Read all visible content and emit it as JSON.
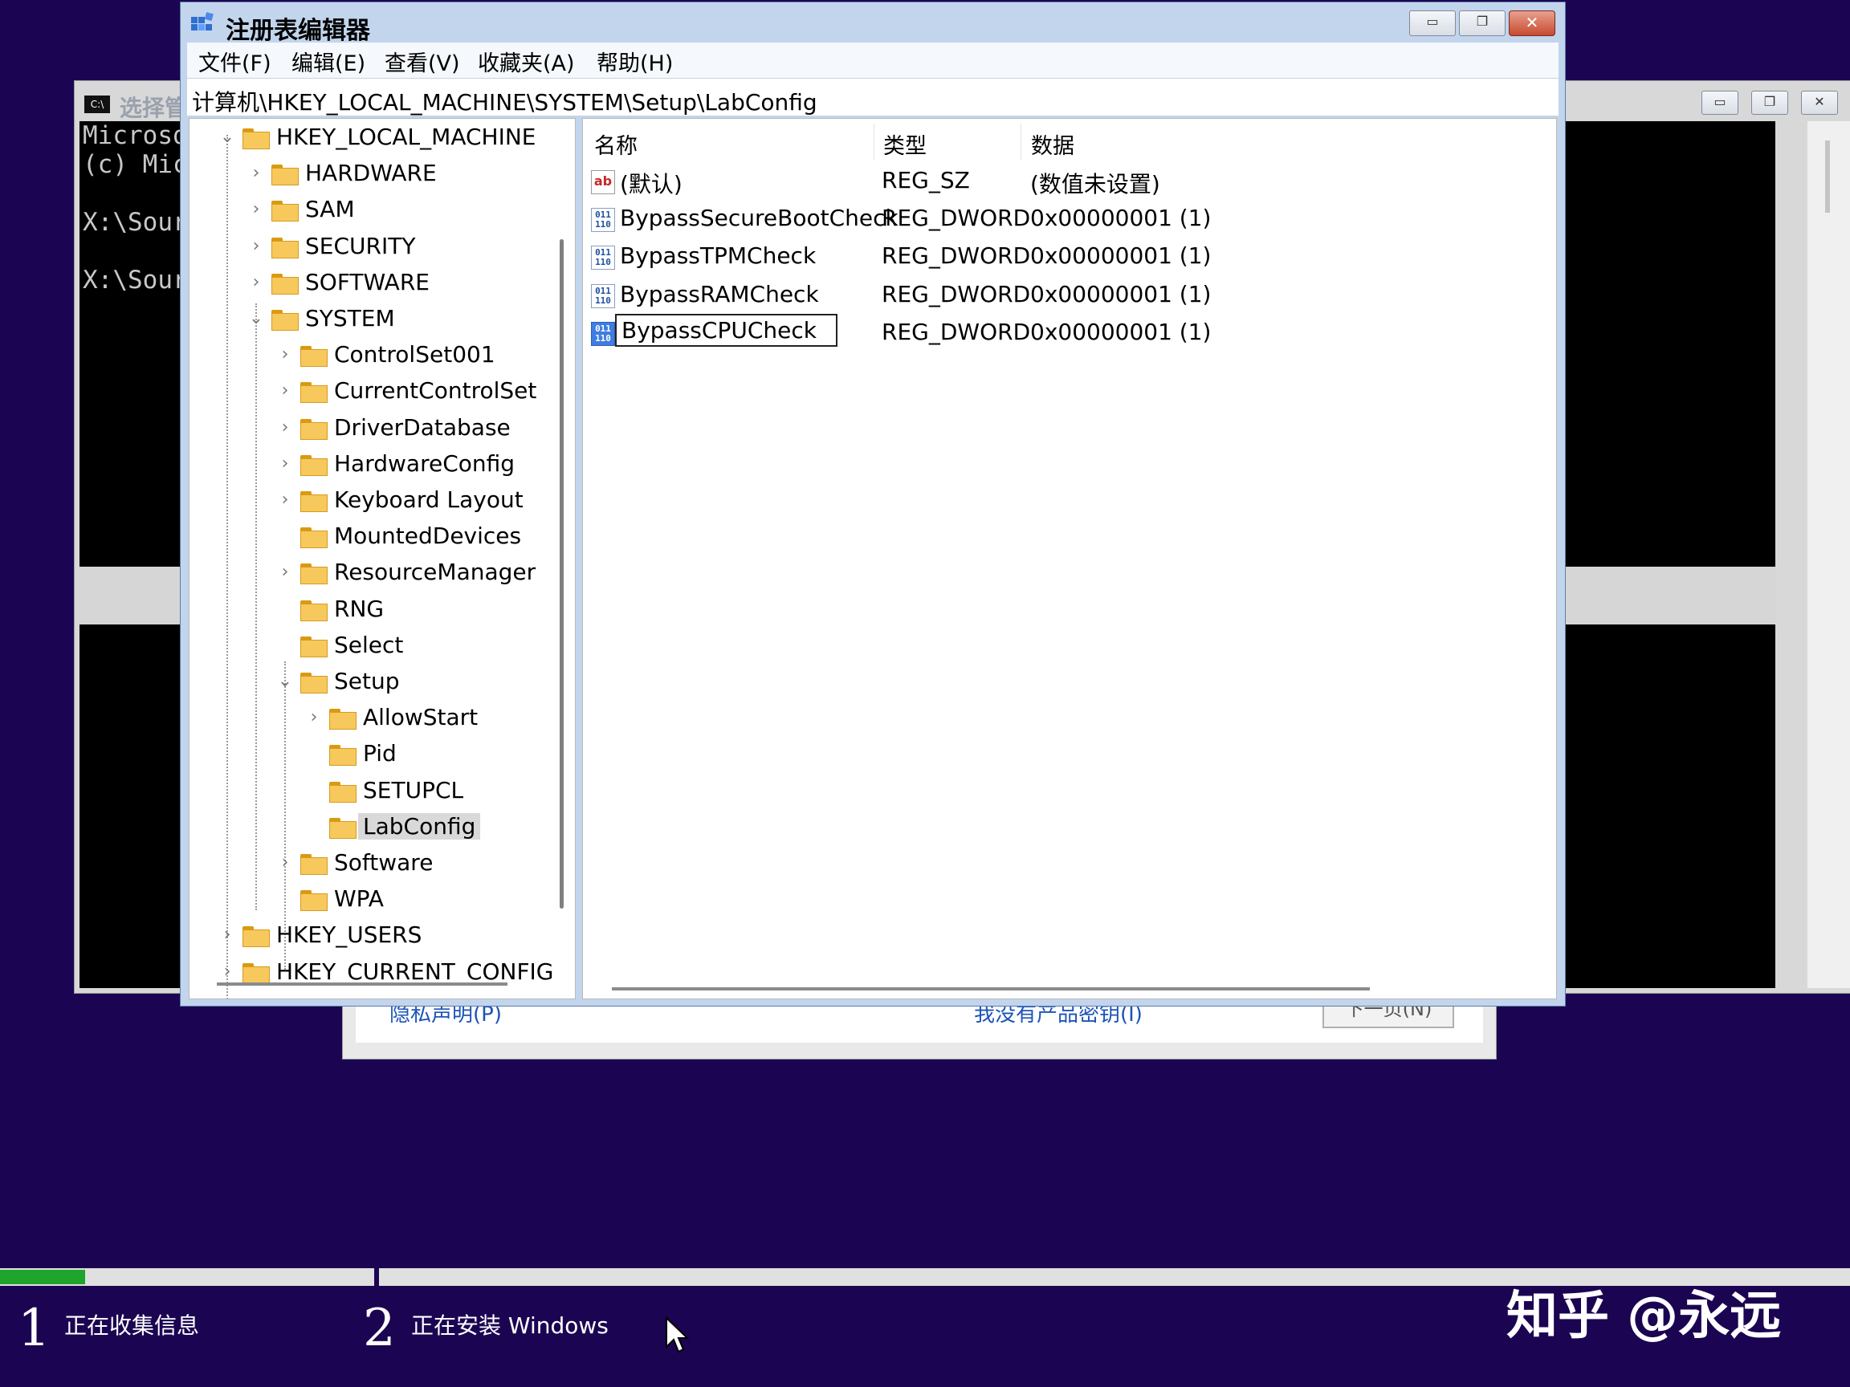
{
  "regedit": {
    "title": "注册表编辑器",
    "menu": [
      "文件(F)",
      "编辑(E)",
      "查看(V)",
      "收藏夹(A)",
      "帮助(H)"
    ],
    "address": "计算机\\HKEY_LOCAL_MACHINE\\SYSTEM\\Setup\\LabConfig",
    "tree": [
      {
        "label": "HKEY_LOCAL_MACHINE",
        "state": "expanded"
      },
      {
        "label": "HARDWARE",
        "state": "collapsed"
      },
      {
        "label": "SAM",
        "state": "collapsed"
      },
      {
        "label": "SECURITY",
        "state": "collapsed"
      },
      {
        "label": "SOFTWARE",
        "state": "collapsed"
      },
      {
        "label": "SYSTEM",
        "state": "expanded"
      },
      {
        "label": "ControlSet001",
        "state": "collapsed"
      },
      {
        "label": "CurrentControlSet",
        "state": "collapsed"
      },
      {
        "label": "DriverDatabase",
        "state": "collapsed"
      },
      {
        "label": "HardwareConfig",
        "state": "collapsed"
      },
      {
        "label": "Keyboard Layout",
        "state": "collapsed"
      },
      {
        "label": "MountedDevices",
        "state": "leaf"
      },
      {
        "label": "ResourceManager",
        "state": "collapsed"
      },
      {
        "label": "RNG",
        "state": "leaf"
      },
      {
        "label": "Select",
        "state": "leaf"
      },
      {
        "label": "Setup",
        "state": "expanded"
      },
      {
        "label": "AllowStart",
        "state": "collapsed"
      },
      {
        "label": "Pid",
        "state": "leaf"
      },
      {
        "label": "SETUPCL",
        "state": "leaf"
      },
      {
        "label": "LabConfig",
        "state": "selected"
      },
      {
        "label": "Software",
        "state": "collapsed"
      },
      {
        "label": "WPA",
        "state": "leaf"
      },
      {
        "label": "HKEY_USERS",
        "state": "collapsed"
      },
      {
        "label": "HKEY_CURRENT_CONFIG",
        "state": "collapsed"
      }
    ],
    "columns": {
      "name": "名称",
      "type": "类型",
      "data": "数据"
    },
    "values": [
      {
        "name": "(默认)",
        "type": "REG_SZ",
        "data": "(数值未设置)",
        "icon": "string-value-icon"
      },
      {
        "name": "BypassSecureBootCheck",
        "type": "REG_DWORD",
        "data": "0x00000001 (1)",
        "icon": "binary-value-icon"
      },
      {
        "name": "BypassTPMCheck",
        "type": "REG_DWORD",
        "data": "0x00000001 (1)",
        "icon": "binary-value-icon"
      },
      {
        "name": "BypassRAMCheck",
        "type": "REG_DWORD",
        "data": "0x00000001 (1)",
        "icon": "binary-value-icon"
      },
      {
        "name": "BypassCPUCheck",
        "type": "REG_DWORD",
        "data": "0x00000001 (1)",
        "icon": "binary-value-icon",
        "editing": true
      }
    ]
  },
  "cmd": {
    "title": "选择管",
    "lines": [
      "Microso",
      "(c) Mic",
      "",
      "X:\\Sour",
      "",
      "X:\\Sour"
    ]
  },
  "setup_dialog": {
    "privacy_link": "隐私声明(P)",
    "middle_link": "我没有产品密钥(I)",
    "next_button": "下一页(N)"
  },
  "setup_progress": {
    "progress": 0.046,
    "steps": [
      {
        "number": "1",
        "label": "正在收集信息"
      },
      {
        "number": "2",
        "label": "正在安装 Windows"
      }
    ]
  },
  "watermark": "知乎 @永远"
}
